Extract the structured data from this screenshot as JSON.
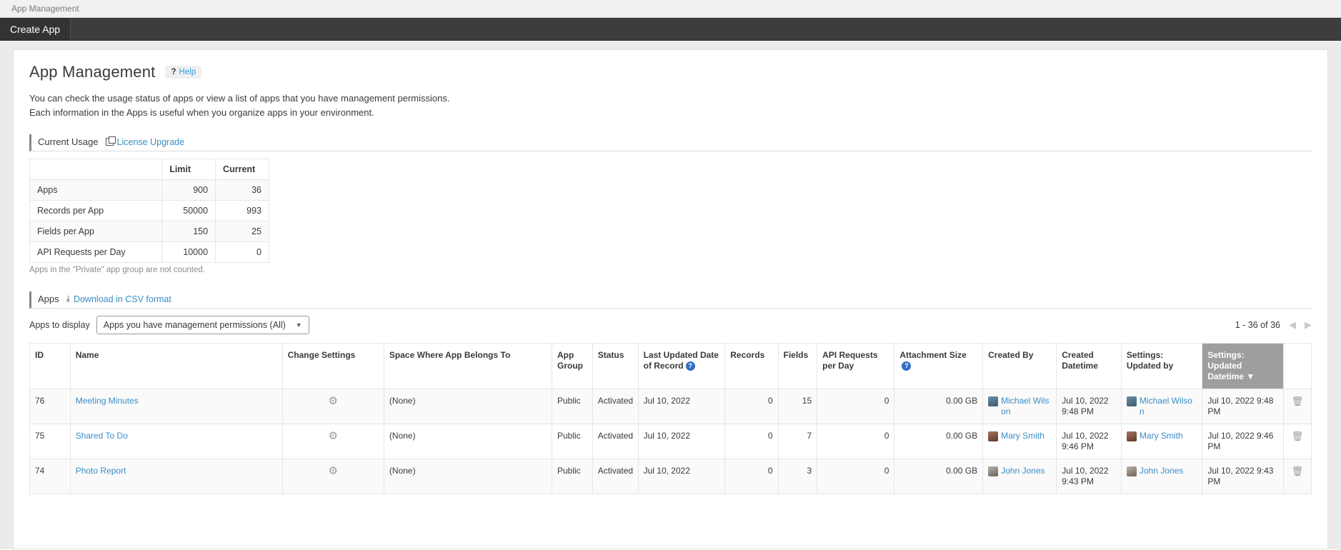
{
  "breadcrumb": {
    "label": "App Management"
  },
  "navbar": {
    "items": [
      {
        "label": "Create App",
        "name": "create-app"
      }
    ]
  },
  "header": {
    "title": "App Management",
    "help_label": "Help",
    "help_qmark": "?",
    "description_line1": "You can check the usage status of apps or view a list of apps that you have management permissions.",
    "description_line2": "Each information in the Apps is useful when you organize apps in your environment."
  },
  "usage_section": {
    "heading": "Current Usage",
    "link_label": "License Upgrade",
    "columns": [
      "",
      "Limit",
      "Current"
    ],
    "rows": [
      {
        "name": "Apps",
        "limit": "900",
        "current": "36"
      },
      {
        "name": "Records per App",
        "limit": "50000",
        "current": "993"
      },
      {
        "name": "Fields per App",
        "limit": "150",
        "current": "25"
      },
      {
        "name": "API Requests per Day",
        "limit": "10000",
        "current": "0"
      }
    ],
    "note": "Apps in the \"Private\" app group are not counted."
  },
  "apps_section": {
    "heading": "Apps",
    "link_label": "Download in CSV format",
    "filter_label": "Apps to display",
    "filter_value": "Apps you have management permissions (All)",
    "pager_count": "1 - 36 of 36",
    "prev_arrow": "◀",
    "next_arrow": "▶",
    "columns": [
      "ID",
      "Name",
      "Change Settings",
      "Space Where App Belongs To",
      "App Group",
      "Status",
      "Last Updated Date of Record",
      "Records",
      "Fields",
      "API Requests per Day",
      "Attachment Size",
      "Created By",
      "Created Datetime",
      "Settings: Updated by",
      "Settings: Updated Datetime",
      ""
    ],
    "sorted_column": "Settings: Updated Datetime",
    "sort_caret": "▼",
    "gear_icon": "⚙",
    "trash_icon": "🗑",
    "rows": [
      {
        "id": "76",
        "name": "Meeting Minutes",
        "space": "(None)",
        "app_group": "Public",
        "status": "Activated",
        "last_updated_record": "Jul 10, 2022",
        "records": "0",
        "fields": "15",
        "api_requests": "0",
        "attachment_size": "0.00 GB",
        "created_by": "Michael Wilson",
        "created_datetime": "Jul 10, 2022 9:48 PM",
        "settings_updated_by": "Michael Wilson",
        "settings_updated_datetime": "Jul 10, 2022 9:48 PM"
      },
      {
        "id": "75",
        "name": "Shared To Do",
        "space": "(None)",
        "app_group": "Public",
        "status": "Activated",
        "last_updated_record": "Jul 10, 2022",
        "records": "0",
        "fields": "7",
        "api_requests": "0",
        "attachment_size": "0.00 GB",
        "created_by": "Mary Smith",
        "created_datetime": "Jul 10, 2022 9:46 PM",
        "settings_updated_by": "Mary Smith",
        "settings_updated_datetime": "Jul 10, 2022 9:46 PM"
      },
      {
        "id": "74",
        "name": "Photo Report",
        "space": "(None)",
        "app_group": "Public",
        "status": "Activated",
        "last_updated_record": "Jul 10, 2022",
        "records": "0",
        "fields": "3",
        "api_requests": "0",
        "attachment_size": "0.00 GB",
        "created_by": "John Jones",
        "created_datetime": "Jul 10, 2022 9:43 PM",
        "settings_updated_by": "John Jones",
        "settings_updated_datetime": "Jul 10, 2022 9:43 PM"
      }
    ]
  },
  "colors": {
    "link": "#3c8dc5",
    "nav_bg": "#3d3d3d",
    "sorted_header_bg": "#9e9e9e"
  }
}
